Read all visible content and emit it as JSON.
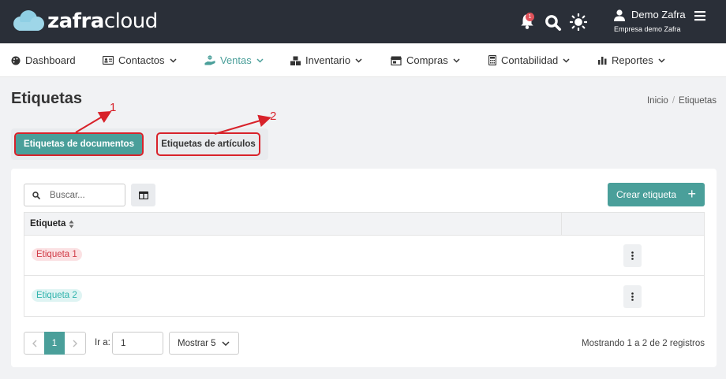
{
  "brand": {
    "bold": "zafra",
    "light": "cloud"
  },
  "header": {
    "notification_count": "1",
    "user_name": "Demo Zafra",
    "company": "Empresa demo Zafra"
  },
  "menu": [
    {
      "label": "Dashboard",
      "icon": "palette-icon",
      "has_dropdown": false,
      "active": false
    },
    {
      "label": "Contactos",
      "icon": "address-card-icon",
      "has_dropdown": true,
      "active": false
    },
    {
      "label": "Ventas",
      "icon": "hand-dollar-icon",
      "has_dropdown": true,
      "active": true
    },
    {
      "label": "Inventario",
      "icon": "boxes-icon",
      "has_dropdown": true,
      "active": false
    },
    {
      "label": "Compras",
      "icon": "store-icon",
      "has_dropdown": true,
      "active": false
    },
    {
      "label": "Contabilidad",
      "icon": "calculator-icon",
      "has_dropdown": true,
      "active": false
    },
    {
      "label": "Reportes",
      "icon": "bar-chart-icon",
      "has_dropdown": true,
      "active": false
    }
  ],
  "page": {
    "title": "Etiquetas",
    "breadcrumb": [
      "Inicio",
      "Etiquetas"
    ]
  },
  "tabs": [
    {
      "label": "Etiquetas de documentos",
      "active": true
    },
    {
      "label": "Etiquetas de artículos",
      "active": false
    }
  ],
  "annotations": [
    "1",
    "2"
  ],
  "toolbar": {
    "search_placeholder": "Buscar...",
    "create_label": "Crear etiqueta"
  },
  "table": {
    "column": "Etiqueta",
    "rows": [
      {
        "label": "Etiqueta 1",
        "color": "#d03a45"
      },
      {
        "label": "Etiqueta 2",
        "color": "#2fb3ac"
      }
    ]
  },
  "pagination": {
    "current_page": "1",
    "goto_label": "Ir a:",
    "goto_value": "1",
    "page_size_label": "Mostrar 5",
    "summary": "Mostrando 1 a 2 de 2 registros"
  },
  "colors": {
    "accent": "#4a9f9a",
    "topbar": "#2a2f38",
    "annotation": "#d8222a"
  }
}
